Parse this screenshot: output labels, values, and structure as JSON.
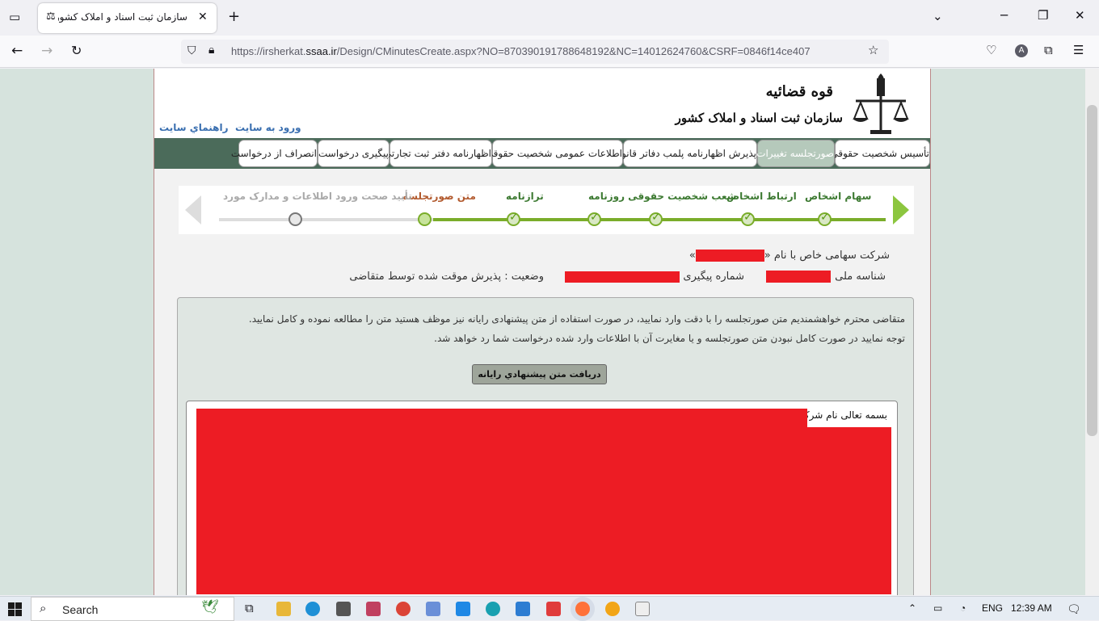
{
  "browser": {
    "tab_title": "سازمان ثبت اسناد و املاک کشور",
    "url_prefix": "https://irsherkat.",
    "url_domain": "ssaa.ir",
    "url_path": "/Design/CMinutesCreate.aspx?NO=870390191788648192&NC=14012624760&CSRF=0846f14ce407"
  },
  "header": {
    "logo_top": "قوه قضائیه",
    "logo_bottom": "سازمان ثبت اسناد و املاک کشور",
    "link_login": "ورود به سايت",
    "link_help": "راهنماي سايت"
  },
  "menu": [
    "تأسیس شخصیت حقوقی",
    "صورتجلسه تغییرات",
    "پذیرش اظهارنامه پلمب دفاتر قانونی",
    "اطلاعات عمومی شخصیت حقوقی",
    "اظهارنامه دفتر ثبت تجارتی",
    "پیگیری درخواست",
    "انصراف از درخواست"
  ],
  "steps": [
    "سهام اشخاص",
    "ارتباط اشخاص",
    "شعب شخصیت حقوقی روزنامه",
    "ترازنامه",
    "متن صورتجلسه",
    "تأیید صحت ورود اطلاعات و مدارک مورد"
  ],
  "company": {
    "title_prefix": "شرکت سهامی خاص با نام «",
    "title_suffix": "»",
    "national_id_label": "شناسه ملی :",
    "tracking_label": "شماره پیگیری :",
    "status": "وضعیت : پذیرش موقت شده توسط متقاضی"
  },
  "notice": {
    "line1": "متقاضی محترم خواهشمندیم متن صورتجلسه را با دقت وارد نمایید، در صورت استفاده از متن پیشنهادی رایانه نیز موظف هستید متن را مطالعه نموده و کامل نمایید.",
    "line2": "توجه نمایید در صورت کامل نبودن متن صورتجلسه و یا مغایرت آن با اطلاعات وارد شده درخواست شما رد خواهد شد.",
    "button": "دريافت متن پيشنهادي رايانه",
    "editor_text": "بسمه تعالی نام شرکت"
  },
  "taskbar": {
    "search": "Search",
    "lang": "ENG",
    "time": "12:39 AM"
  },
  "colors": {
    "menu_bg": "#4b6b5a",
    "redaction": "#ed1c24",
    "step_done": "#3d7a32",
    "step_current": "#b25a2e"
  }
}
